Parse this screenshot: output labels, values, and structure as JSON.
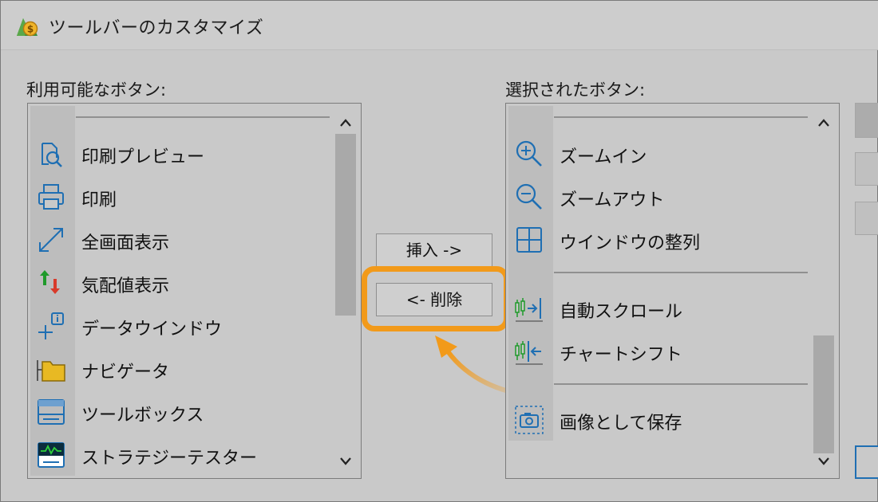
{
  "window": {
    "title": "ツールバーのカスタマイズ",
    "icon": "metatrader-app-icon"
  },
  "available": {
    "label": "利用可能なボタン:",
    "items": [
      {
        "label": "印刷プレビュー",
        "icon": "print-preview-icon"
      },
      {
        "label": "印刷",
        "icon": "printer-icon"
      },
      {
        "label": "全画面表示",
        "icon": "fullscreen-icon"
      },
      {
        "label": "気配値表示",
        "icon": "market-watch-icon"
      },
      {
        "label": "データウインドウ",
        "icon": "data-window-icon"
      },
      {
        "label": "ナビゲータ",
        "icon": "navigator-icon"
      },
      {
        "label": "ツールボックス",
        "icon": "toolbox-icon"
      },
      {
        "label": "ストラテジーテスター",
        "icon": "strategy-tester-icon"
      }
    ]
  },
  "buttons": {
    "insert": "挿入 ->",
    "remove": "<- 削除"
  },
  "selected": {
    "label": "選択されたボタン:",
    "items": [
      {
        "label": "ズームイン",
        "icon": "zoom-in-icon"
      },
      {
        "label": "ズームアウト",
        "icon": "zoom-out-icon"
      },
      {
        "label": "ウインドウの整列",
        "icon": "tile-windows-icon"
      },
      {
        "label": "自動スクロール",
        "icon": "auto-scroll-icon"
      },
      {
        "label": "チャートシフト",
        "icon": "chart-shift-icon"
      },
      {
        "label": "画像として保存",
        "icon": "save-as-picture-icon"
      }
    ]
  },
  "colors": {
    "highlight": "#f29a1a",
    "icon_blue": "#1f6fb3",
    "icon_green": "#1f9a2a",
    "icon_red": "#d83a2a",
    "folder_yellow": "#e8b923"
  }
}
